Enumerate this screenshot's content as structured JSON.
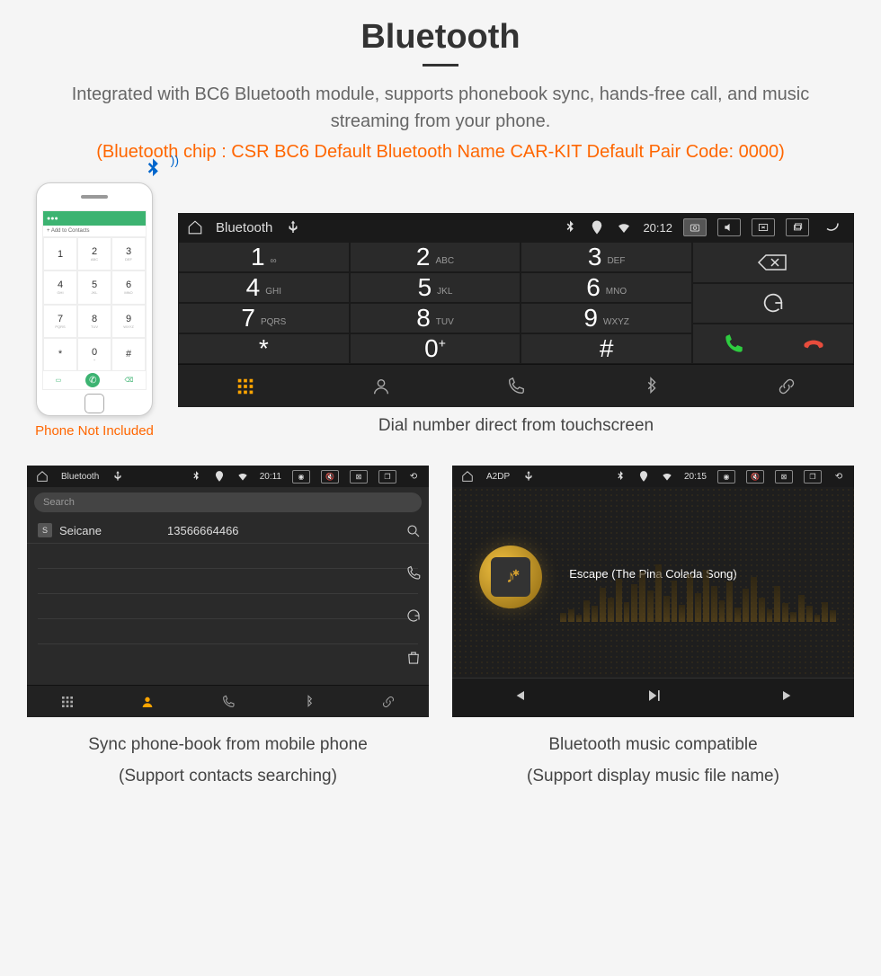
{
  "header": {
    "title": "Bluetooth",
    "desc": "Integrated with BC6 Bluetooth module, supports phonebook sync, hands-free call, and music streaming from your phone.",
    "specs": "(Bluetooth chip : CSR BC6     Default Bluetooth Name CAR-KIT     Default Pair Code: 0000)"
  },
  "phone": {
    "caption": "Phone Not Included",
    "add_contacts": "+  Add to Contacts",
    "keys": [
      {
        "n": "1",
        "s": ""
      },
      {
        "n": "2",
        "s": "ABC"
      },
      {
        "n": "3",
        "s": "DEF"
      },
      {
        "n": "4",
        "s": "GHI"
      },
      {
        "n": "5",
        "s": "JKL"
      },
      {
        "n": "6",
        "s": "MNO"
      },
      {
        "n": "7",
        "s": "PQRS"
      },
      {
        "n": "8",
        "s": "TUV"
      },
      {
        "n": "9",
        "s": "WXYZ"
      },
      {
        "n": "*",
        "s": ""
      },
      {
        "n": "0",
        "s": "+"
      },
      {
        "n": "#",
        "s": ""
      }
    ]
  },
  "dialer": {
    "status": {
      "title": "Bluetooth",
      "time": "20:12"
    },
    "keys": [
      {
        "n": "1",
        "s": "∞"
      },
      {
        "n": "2",
        "s": "ABC"
      },
      {
        "n": "3",
        "s": "DEF"
      },
      {
        "n": "4",
        "s": "GHI"
      },
      {
        "n": "5",
        "s": "JKL"
      },
      {
        "n": "6",
        "s": "MNO"
      },
      {
        "n": "7",
        "s": "PQRS"
      },
      {
        "n": "8",
        "s": "TUV"
      },
      {
        "n": "9",
        "s": "WXYZ"
      },
      {
        "n": "*",
        "s": ""
      },
      {
        "n": "0",
        "s": "+",
        "sup": true
      },
      {
        "n": "#",
        "s": ""
      }
    ],
    "caption": "Dial number direct from touchscreen"
  },
  "phonebook": {
    "status": {
      "title": "Bluetooth",
      "time": "20:11"
    },
    "search_placeholder": "Search",
    "contact": {
      "badge": "S",
      "name": "Seicane",
      "number": "13566664466"
    },
    "caption_l1": "Sync phone-book from mobile phone",
    "caption_l2": "(Support contacts searching)"
  },
  "music": {
    "status": {
      "title": "A2DP",
      "time": "20:15"
    },
    "track": "Escape (The Pina Colada Song)",
    "caption_l1": "Bluetooth music compatible",
    "caption_l2": "(Support display music file name)"
  },
  "eq_heights": [
    12,
    18,
    10,
    30,
    22,
    48,
    34,
    60,
    28,
    52,
    70,
    44,
    80,
    36,
    58,
    24,
    66,
    40,
    72,
    50,
    30,
    56,
    20,
    46,
    62,
    34,
    18,
    50,
    26,
    14,
    38,
    22,
    10,
    28,
    16
  ]
}
